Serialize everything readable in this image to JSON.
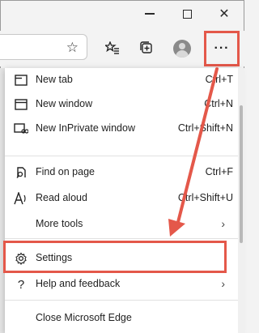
{
  "window_controls": {
    "minimize_icon": "minimize-icon",
    "maximize_icon": "maximize-icon",
    "close_glyph": "✕"
  },
  "toolbar": {
    "favorite_glyph": "☆",
    "more_glyph": "···"
  },
  "menu": {
    "items": [
      {
        "label": "New tab",
        "shortcut": "Ctrl+T",
        "icon": "new-tab-icon"
      },
      {
        "label": "New window",
        "shortcut": "Ctrl+N",
        "icon": "new-window-icon"
      },
      {
        "label": "New InPrivate window",
        "shortcut": "Ctrl+Shift+N",
        "icon": "inprivate-icon"
      },
      {
        "label": "Find on page",
        "shortcut": "Ctrl+F",
        "icon": "find-icon"
      },
      {
        "label": "Read aloud",
        "shortcut": "Ctrl+Shift+U",
        "icon": "read-aloud-icon"
      },
      {
        "label": "More tools",
        "shortcut": "",
        "icon": ""
      },
      {
        "label": "Settings",
        "shortcut": "",
        "icon": "gear-icon"
      },
      {
        "label": "Help and feedback",
        "shortcut": "",
        "icon": "help-icon"
      },
      {
        "label": "Close Microsoft Edge",
        "shortcut": "",
        "icon": ""
      }
    ],
    "chevron": "›",
    "question_glyph": "?"
  },
  "colors": {
    "highlight": "#e4584a"
  }
}
